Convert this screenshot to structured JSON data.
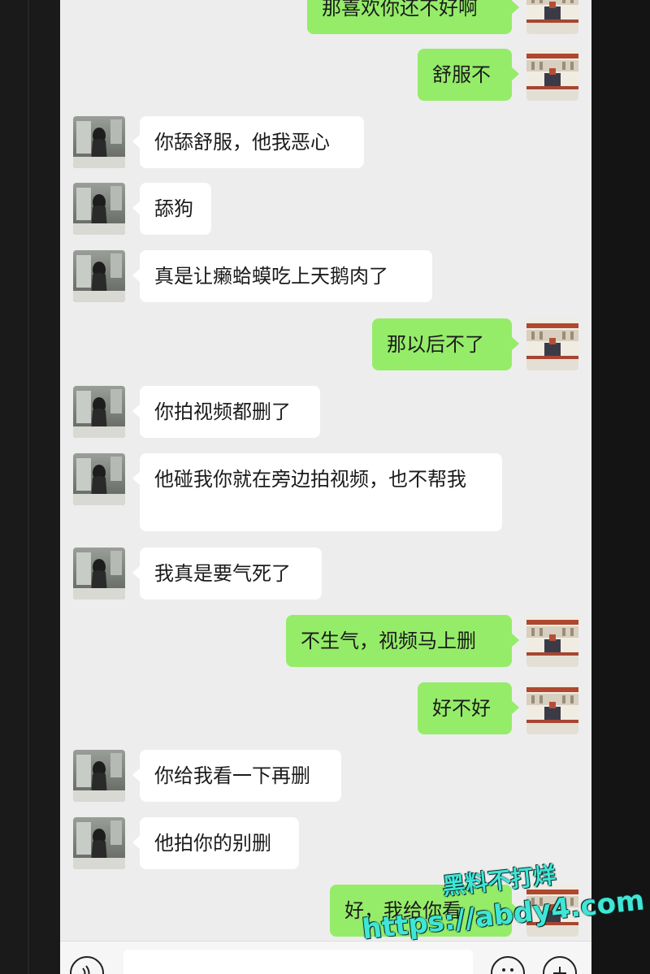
{
  "colors": {
    "chat_background": "#ededed",
    "incoming_bubble": "#ffffff",
    "outgoing_bubble": "#95ec69",
    "watermark": "#3fe6d6"
  },
  "messages": [
    {
      "side": "right",
      "text": "那喜欢你还不好啊"
    },
    {
      "side": "right",
      "text": "舒服不"
    },
    {
      "side": "left",
      "text": "你舔舒服，他我恶心"
    },
    {
      "side": "left",
      "text": "舔狗"
    },
    {
      "side": "left",
      "text": "真是让癞蛤蟆吃上天鹅肉了"
    },
    {
      "side": "right",
      "text": "那以后不了"
    },
    {
      "side": "left",
      "text": "你拍视频都删了"
    },
    {
      "side": "left",
      "text": "他碰我你就在旁边拍视频，也不帮我"
    },
    {
      "side": "left",
      "text": "我真是要气死了"
    },
    {
      "side": "right",
      "text": "不生气，视频马上删"
    },
    {
      "side": "right",
      "text": "好不好"
    },
    {
      "side": "left",
      "text": "你给我看一下再删"
    },
    {
      "side": "left",
      "text": "他拍你的别删"
    },
    {
      "side": "right",
      "text": "好，我给你看"
    }
  ],
  "input_bar": {
    "voice_icon": "voice-icon",
    "emoji_icon": "emoji-icon",
    "plus_icon": "plus-icon"
  },
  "watermark": {
    "line1": "黑料不打烊",
    "line2": "https://abdy4.com"
  }
}
